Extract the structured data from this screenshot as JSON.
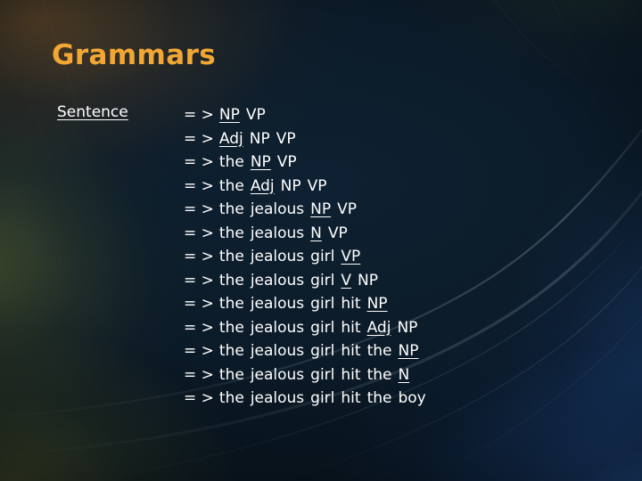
{
  "slide": {
    "title": "Grammars",
    "label": "Sentence",
    "arrow": "= >",
    "colors": {
      "title": "#f2a734",
      "text": "#ffffff",
      "background_base": "#0b1722",
      "glow_warm": "#96622 6",
      "glow_olive": "#7c8034",
      "glow_blue": "#3476d2"
    },
    "derivation": [
      {
        "id": 1,
        "tokens": [
          {
            "t": "NP",
            "u": true
          },
          {
            "t": "VP",
            "u": false
          }
        ]
      },
      {
        "id": 2,
        "tokens": [
          {
            "t": "Adj",
            "u": true
          },
          {
            "t": "NP",
            "u": false
          },
          {
            "t": "VP",
            "u": false
          }
        ]
      },
      {
        "id": 3,
        "tokens": [
          {
            "t": "the",
            "u": false
          },
          {
            "t": "NP",
            "u": true
          },
          {
            "t": "VP",
            "u": false
          }
        ]
      },
      {
        "id": 4,
        "tokens": [
          {
            "t": "the",
            "u": false
          },
          {
            "t": "Adj",
            "u": true
          },
          {
            "t": "NP",
            "u": false
          },
          {
            "t": "VP",
            "u": false
          }
        ]
      },
      {
        "id": 5,
        "tokens": [
          {
            "t": "the",
            "u": false
          },
          {
            "t": "jealous",
            "u": false
          },
          {
            "t": "NP",
            "u": true
          },
          {
            "t": "VP",
            "u": false
          }
        ]
      },
      {
        "id": 6,
        "tokens": [
          {
            "t": "the",
            "u": false
          },
          {
            "t": "jealous",
            "u": false
          },
          {
            "t": "N",
            "u": true
          },
          {
            "t": "VP",
            "u": false
          }
        ]
      },
      {
        "id": 7,
        "tokens": [
          {
            "t": "the",
            "u": false
          },
          {
            "t": "jealous",
            "u": false
          },
          {
            "t": "girl",
            "u": false
          },
          {
            "t": "VP",
            "u": true
          }
        ]
      },
      {
        "id": 8,
        "tokens": [
          {
            "t": "the",
            "u": false
          },
          {
            "t": "jealous",
            "u": false
          },
          {
            "t": "girl",
            "u": false
          },
          {
            "t": "V",
            "u": true
          },
          {
            "t": "NP",
            "u": false
          }
        ]
      },
      {
        "id": 9,
        "tokens": [
          {
            "t": "the",
            "u": false
          },
          {
            "t": "jealous",
            "u": false
          },
          {
            "t": "girl",
            "u": false
          },
          {
            "t": "hit",
            "u": false
          },
          {
            "t": "NP",
            "u": true
          }
        ]
      },
      {
        "id": 10,
        "tokens": [
          {
            "t": "the",
            "u": false
          },
          {
            "t": "jealous",
            "u": false
          },
          {
            "t": "girl",
            "u": false
          },
          {
            "t": "hit",
            "u": false
          },
          {
            "t": "Adj",
            "u": true
          },
          {
            "t": "NP",
            "u": false
          }
        ]
      },
      {
        "id": 11,
        "tokens": [
          {
            "t": "the",
            "u": false
          },
          {
            "t": "jealous",
            "u": false
          },
          {
            "t": "girl",
            "u": false
          },
          {
            "t": "hit",
            "u": false
          },
          {
            "t": "the",
            "u": false
          },
          {
            "t": "NP",
            "u": true
          }
        ]
      },
      {
        "id": 12,
        "tokens": [
          {
            "t": "the",
            "u": false
          },
          {
            "t": "jealous",
            "u": false
          },
          {
            "t": "girl",
            "u": false
          },
          {
            "t": "hit",
            "u": false
          },
          {
            "t": "the",
            "u": false
          },
          {
            "t": "N",
            "u": true
          }
        ]
      },
      {
        "id": 13,
        "tokens": [
          {
            "t": "the",
            "u": false
          },
          {
            "t": "jealous",
            "u": false
          },
          {
            "t": "girl",
            "u": false
          },
          {
            "t": "hit",
            "u": false
          },
          {
            "t": "the",
            "u": false
          },
          {
            "t": "boy",
            "u": false
          }
        ]
      }
    ]
  }
}
